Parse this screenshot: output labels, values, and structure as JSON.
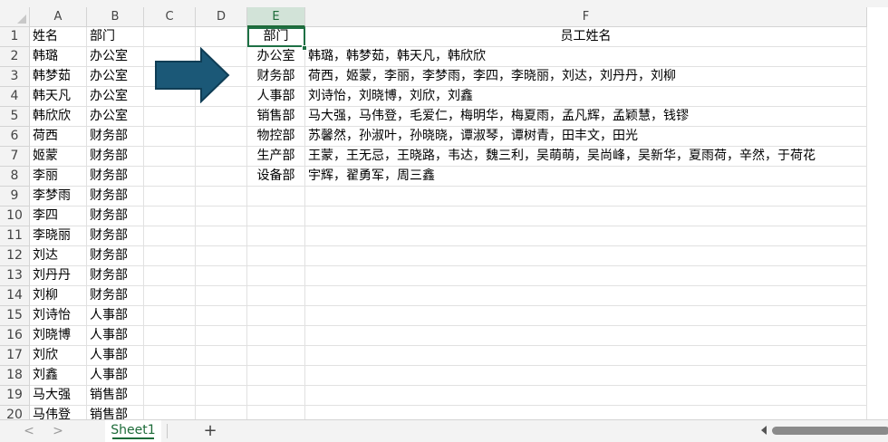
{
  "columns": [
    {
      "id": "A",
      "label": "A"
    },
    {
      "id": "B",
      "label": "B"
    },
    {
      "id": "C",
      "label": "C"
    },
    {
      "id": "D",
      "label": "D"
    },
    {
      "id": "E",
      "label": "E"
    },
    {
      "id": "F",
      "label": "F"
    }
  ],
  "active_column": "E",
  "selected_cell": "E1",
  "rows": [
    "1",
    "2",
    "3",
    "4",
    "5",
    "6",
    "7",
    "8",
    "9",
    "10",
    "11",
    "12",
    "13",
    "14",
    "15",
    "16",
    "17",
    "18",
    "19",
    "20"
  ],
  "col_a": [
    "姓名",
    "韩璐",
    "韩梦茹",
    "韩天凡",
    "韩欣欣",
    "荷西",
    "姬蒙",
    "李丽",
    "李梦雨",
    "李四",
    "李晓丽",
    "刘达",
    "刘丹丹",
    "刘柳",
    "刘诗怡",
    "刘晓博",
    "刘欣",
    "刘鑫",
    "马大强",
    "马伟登"
  ],
  "col_b": [
    "部门",
    "办公室",
    "办公室",
    "办公室",
    "办公室",
    "财务部",
    "财务部",
    "财务部",
    "财务部",
    "财务部",
    "财务部",
    "财务部",
    "财务部",
    "财务部",
    "人事部",
    "人事部",
    "人事部",
    "人事部",
    "销售部",
    "销售部"
  ],
  "col_e": [
    "部门",
    "办公室",
    "财务部",
    "人事部",
    "销售部",
    "物控部",
    "生产部",
    "设备部"
  ],
  "col_f": [
    "员工姓名",
    "韩璐，韩梦茹，韩天凡，韩欣欣",
    "荷西，姬蒙，李丽，李梦雨，李四，李晓丽，刘达，刘丹丹，刘柳",
    "刘诗怡，刘晓博，刘欣，刘鑫",
    "马大强，马伟登，毛爱仁，梅明华，梅夏雨，孟凡辉，孟颖慧，钱镠",
    "苏馨然，孙淑叶，孙晓晓，谭淑琴，谭树青，田丰文，田光",
    "王蒙，王无忌，王晓路，韦达，魏三利，吴萌萌，吴尚峰，吴新华，夏雨荷，辛然，于荷花",
    "宇辉，翟勇军，周三鑫"
  ],
  "arrow_color": "#1b5877",
  "sheet_tab": {
    "label": "Sheet1"
  },
  "add_sheet_label": "+",
  "nav": {
    "prev": "<",
    "next": ">"
  }
}
